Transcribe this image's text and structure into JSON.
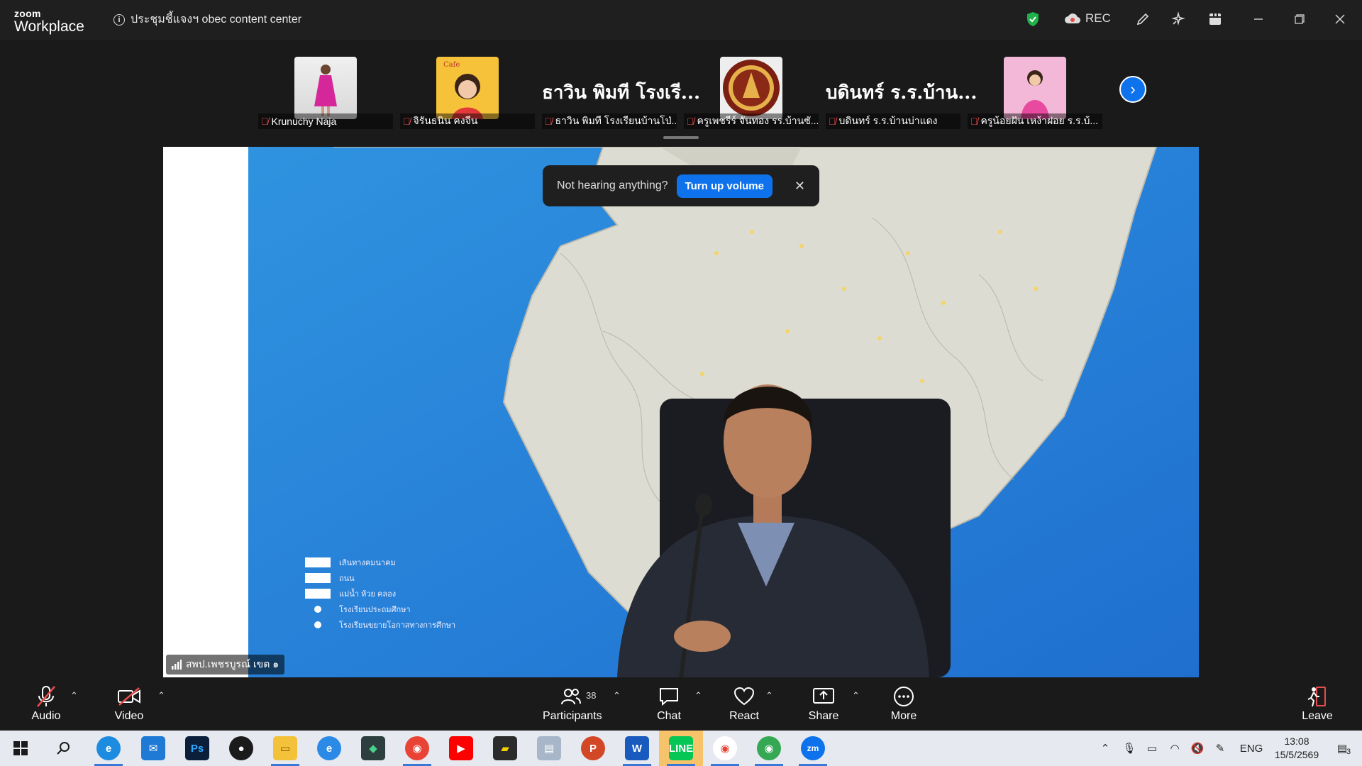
{
  "app": {
    "logo_line1": "zoom",
    "logo_line2": "Workplace",
    "meeting_title": "ประชุมชี้แจงฯ obec content center",
    "rec_label": "REC"
  },
  "gallery": {
    "tiles": [
      {
        "name": "Krunuchy Naja",
        "big_name": ""
      },
      {
        "name": "จิรันธนิน คงจีน",
        "big_name": ""
      },
      {
        "name": "ธาวิน พิมที โรงเรียนบ้านโป่...",
        "big_name": "ธาวิน พิมที โรงเรี..."
      },
      {
        "name": "ครูเพชรีร์ จันทอง รร.บ้านซั...",
        "big_name": ""
      },
      {
        "name": "บดินทร์ ร.ร.บ้านบ่าแดง",
        "big_name": "บดินทร์ ร.ร.บ้าน..."
      },
      {
        "name": "ครูน้อยฝัน เหง้าฝอย ร.ร.บ้...",
        "big_name": ""
      }
    ]
  },
  "toast": {
    "text": "Not hearing anything?",
    "button": "Turn up volume",
    "close": "✕"
  },
  "video": {
    "speaker_label": "สพป.เพชรบูรณ์ เขต ๑",
    "legend": [
      "เส้นทางคมนาคม",
      "ถนน",
      "แม่น้ำ ห้วย คลอง",
      "โรงเรียนประถมศึกษา",
      "โรงเรียนขยายโอกาสทางการศึกษา"
    ]
  },
  "controls": {
    "audio": "Audio",
    "video": "Video",
    "participants": "Participants",
    "participants_count": "38",
    "chat": "Chat",
    "react": "React",
    "share": "Share",
    "more": "More",
    "leave": "Leave"
  },
  "taskbar": {
    "lang": "ENG",
    "time": "13:08",
    "date": "15/5/2569",
    "notif_count": "3"
  },
  "colors": {
    "accent": "#0e72ed",
    "muted_red": "#e84c4c",
    "shield_green": "#1fb24a"
  }
}
